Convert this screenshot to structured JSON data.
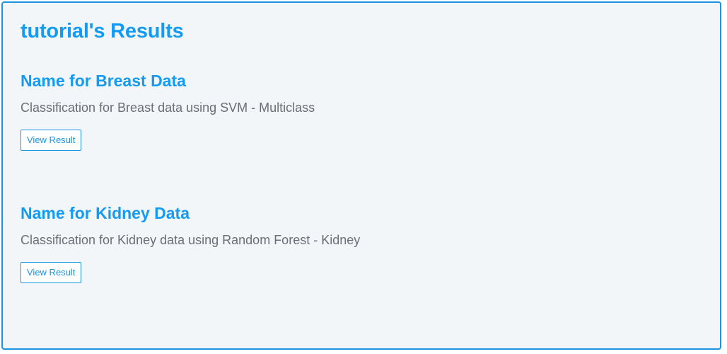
{
  "page": {
    "title": "tutorial's Results"
  },
  "results": [
    {
      "title": "Name for Breast Data",
      "description": "Classification for Breast data using SVM - Multiclass",
      "button_label": "View Result"
    },
    {
      "title": "Name for Kidney Data",
      "description": "Classification for Kidney data using Random Forest - Kidney",
      "button_label": "View Result"
    }
  ],
  "colors": {
    "accent": "#129bf4",
    "border": "#1b95e0",
    "panel_background": "#f3f6f9",
    "description_text": "#6b6f73"
  }
}
